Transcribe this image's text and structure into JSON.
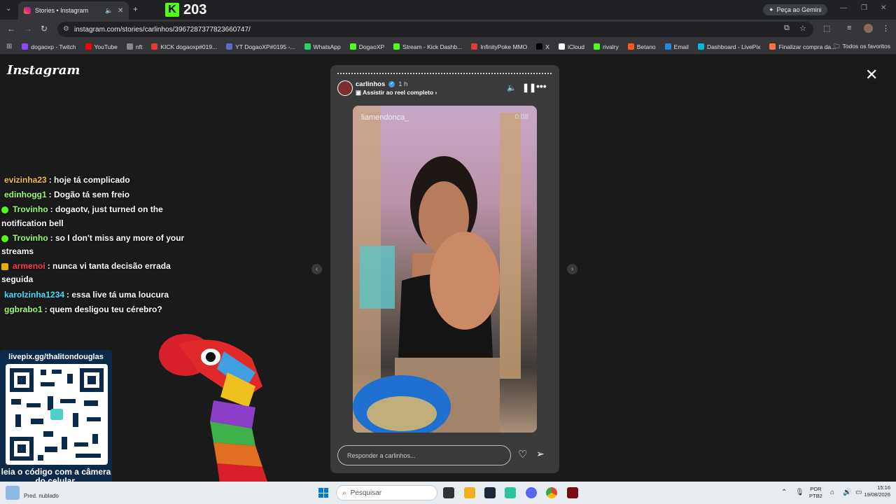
{
  "browser": {
    "tab_title": "Stories • Instagram",
    "kick_counter": "203",
    "gemini_label": "Peça ao Gemini",
    "url": "instagram.com/stories/carlinhos/3967287377823660747/",
    "bookmarks": [
      {
        "label": "dogaoxp - Twitch",
        "color": "#9146ff"
      },
      {
        "label": "YouTube",
        "color": "#ff0000"
      },
      {
        "label": "nft",
        "color": "#888888"
      },
      {
        "label": "KICK dogaoxp#019...",
        "color": "#e53935"
      },
      {
        "label": "YT DogaoXP#0195 -...",
        "color": "#5c6bc0"
      },
      {
        "label": "WhatsApp",
        "color": "#25d366"
      },
      {
        "label": "DogaoXP",
        "color": "#53fc18"
      },
      {
        "label": "Stream - Kick Dashb...",
        "color": "#53fc18"
      },
      {
        "label": "InfinityPoke MMO",
        "color": "#e53935"
      },
      {
        "label": "X",
        "color": "#000000"
      },
      {
        "label": "iCloud",
        "color": "#ffffff"
      },
      {
        "label": "rivalry",
        "color": "#53fc18"
      },
      {
        "label": "Betano",
        "color": "#ff5722"
      },
      {
        "label": "Email",
        "color": "#1e88e5"
      },
      {
        "label": "Dashboard - LivePix",
        "color": "#00bcd4"
      },
      {
        "label": "Finalizar compra da...",
        "color": "#ff7043"
      }
    ],
    "all_favorites": "Todos os favoritos"
  },
  "instagram": {
    "logo": "Instagram",
    "story": {
      "username": "carlinhos",
      "time": "1 h",
      "watch_full": "Assistir ao reel completo",
      "embedded_user": "liamendonca_",
      "embedded_time": "0:08",
      "reply_placeholder": "Responder a carlinhos..."
    }
  },
  "overlay": {
    "chat": [
      {
        "user": "evizinha23",
        "text": ": hoje tá complicado",
        "color": "#f0c040",
        "badge": ""
      },
      {
        "user": "edinhogg1",
        "text": ": Dogão tá sem freio",
        "color": "#9cff6b",
        "badge": ""
      },
      {
        "user": "Trovinho",
        "text": ": dogaotv, just turned on the notification bell",
        "color": "#9cff6b",
        "badge": "green"
      },
      {
        "user": "Trovinho",
        "text": ": so I don't miss any more of your streams",
        "color": "#9cff6b",
        "badge": "green"
      },
      {
        "user": "armenoi",
        "text": ": nunca vi tanta decisão errada seguida",
        "color": "#ff4040",
        "badge": "gold"
      },
      {
        "user": "karolzinha1234",
        "text": ": essa live tá uma loucura",
        "color": "#40e0ff",
        "badge": ""
      },
      {
        "user": "ggbrabo1",
        "text": ": quem desligou teu cérebro?",
        "color": "#9cff6b",
        "badge": ""
      }
    ],
    "qr_url": "livepix.gg/thalitondouglas",
    "qr_caption": "leia o código com a câmera do celular."
  },
  "taskbar": {
    "weather": "Pred. nublado",
    "search_placeholder": "Pesquisar",
    "lang_line1": "POR",
    "lang_line2": "PTB2",
    "clock_time": "15:16",
    "clock_date": "19/08/2026"
  }
}
